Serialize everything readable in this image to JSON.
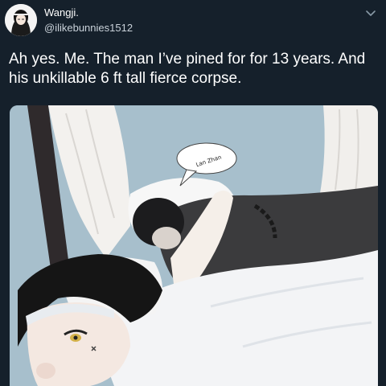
{
  "tweet": {
    "display_name": "Wangji.",
    "handle": "@ilikebunnies1512",
    "text": "Ah yes. Me. The man I’ve pined for for 13 years. And his unkillable 6 ft tall fierce corpse."
  },
  "media": {
    "speech_bubble_text": "Lan Zhan"
  },
  "icons": {
    "avatar": "avatar",
    "menu": "chevron-down-icon"
  },
  "colors": {
    "background": "#15202b",
    "text": "#ffffff",
    "secondary_text": "#c9d1d9"
  }
}
